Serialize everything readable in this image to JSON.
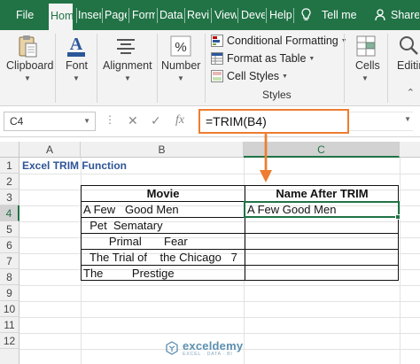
{
  "tabs": [
    {
      "label": "File"
    },
    {
      "label": "Hom"
    },
    {
      "label": "Inser"
    },
    {
      "label": "Page"
    },
    {
      "label": "Form"
    },
    {
      "label": "Data"
    },
    {
      "label": "Revie"
    },
    {
      "label": "View"
    },
    {
      "label": "Deve"
    },
    {
      "label": "Help"
    },
    {
      "label": "Tell me"
    },
    {
      "label": "Share"
    }
  ],
  "ribbon": {
    "clipboard": "Clipboard",
    "font": "Font",
    "alignment": "Alignment",
    "number": "Number",
    "conditional_formatting": "Conditional Formatting",
    "format_as_table": "Format as Table",
    "cell_styles": "Cell Styles",
    "styles": "Styles",
    "cells": "Cells",
    "editing": "Editing"
  },
  "formula_bar": {
    "name_box": "C4",
    "fx": "fx",
    "cancel": "✕",
    "enter": "✓",
    "formula": "=TRIM(B4)"
  },
  "columns": [
    "A",
    "B",
    "C"
  ],
  "rows": [
    "1",
    "2",
    "3",
    "4",
    "5",
    "6",
    "7",
    "8",
    "9",
    "10",
    "11",
    "12"
  ],
  "sheet": {
    "title": "Excel TRIM Function",
    "header_movie": "Movie",
    "header_after": "Name After TRIM",
    "movies": [
      "A Few   Good Men",
      "  Pet  Sematary",
      "        Primal       Fear",
      "  The Trial of    the Chicago   7",
      "The         Prestige"
    ],
    "trimmed": [
      "A Few Good Men",
      "",
      "",
      "",
      ""
    ]
  },
  "watermark": {
    "name": "exceldemy",
    "tagline": "EXCEL · DATA · BI"
  },
  "colors": {
    "excel_green": "#217346",
    "highlight_orange": "#ed7d31",
    "title_blue": "#2e5597"
  }
}
